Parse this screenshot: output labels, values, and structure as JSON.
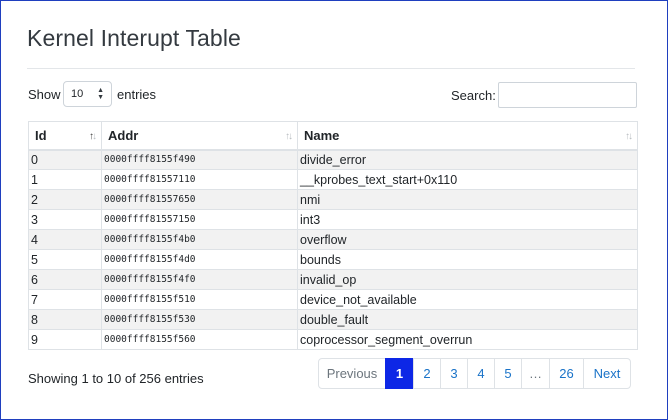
{
  "page": {
    "title": "Kernel Interupt Table"
  },
  "length_control": {
    "show_label": "Show",
    "value": "10",
    "entries_label": "entries"
  },
  "search": {
    "label": "Search:",
    "value": ""
  },
  "table": {
    "headers": {
      "id": "Id",
      "addr": "Addr",
      "name": "Name"
    },
    "rows": [
      {
        "id": "0",
        "addr": "0000ffff8155f490",
        "name": "divide_error"
      },
      {
        "id": "1",
        "addr": "0000ffff81557110",
        "name": "__kprobes_text_start+0x110"
      },
      {
        "id": "2",
        "addr": "0000ffff81557650",
        "name": "nmi"
      },
      {
        "id": "3",
        "addr": "0000ffff81557150",
        "name": "int3"
      },
      {
        "id": "4",
        "addr": "0000ffff8155f4b0",
        "name": "overflow"
      },
      {
        "id": "5",
        "addr": "0000ffff8155f4d0",
        "name": "bounds"
      },
      {
        "id": "6",
        "addr": "0000ffff8155f4f0",
        "name": "invalid_op"
      },
      {
        "id": "7",
        "addr": "0000ffff8155f510",
        "name": "device_not_available"
      },
      {
        "id": "8",
        "addr": "0000ffff8155f530",
        "name": "double_fault"
      },
      {
        "id": "9",
        "addr": "0000ffff8155f560",
        "name": "coprocessor_segment_overrun"
      }
    ]
  },
  "info": "Showing 1 to 10 of 256 entries",
  "pagination": {
    "previous": "Previous",
    "pages": [
      "1",
      "2",
      "3",
      "4",
      "5"
    ],
    "ellipsis": "…",
    "last_page": "26",
    "next": "Next",
    "current": "1"
  },
  "colors": {
    "frame": "#1f3fbf",
    "active_page": "#0d27e6",
    "link": "#1a73c8",
    "stripe": "#f2f2f2"
  },
  "icons": {
    "sort": "sort-both-icon",
    "select": "select-arrows-icon"
  }
}
